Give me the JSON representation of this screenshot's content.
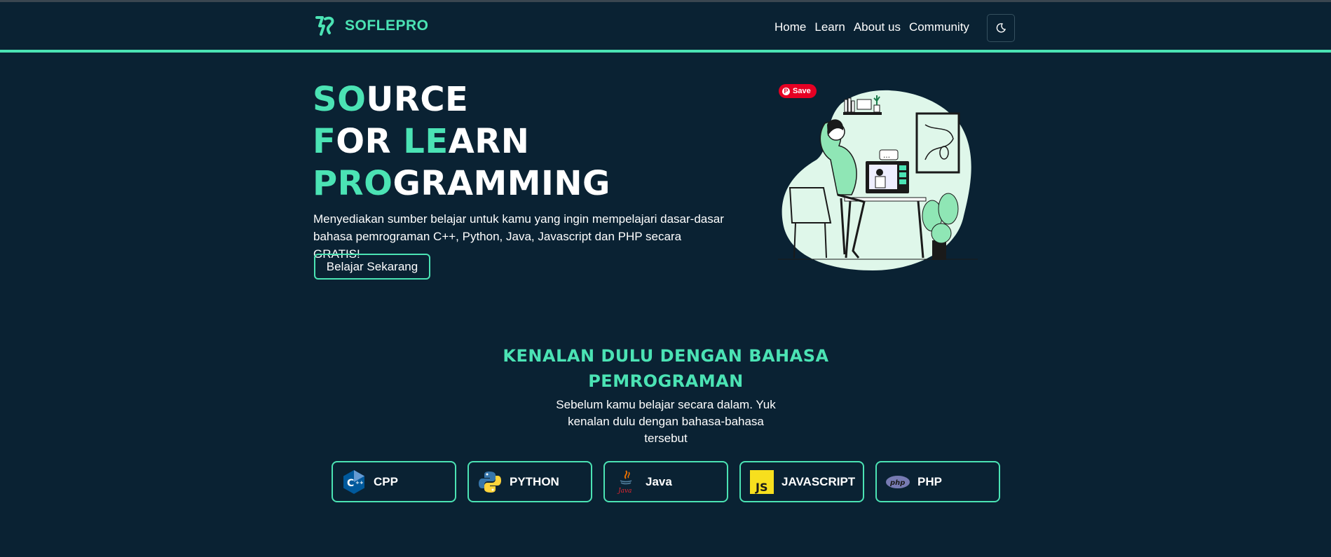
{
  "brand": {
    "name": "SOFLEPRO"
  },
  "nav": {
    "links": [
      "Home",
      "Learn",
      "About us",
      "Community"
    ],
    "theme_icon": "moon-icon"
  },
  "hero": {
    "title_lines": [
      {
        "accent": "SO",
        "rest": "URCE"
      },
      {
        "accent1": "F",
        "mid": "OR ",
        "accent2": "LE",
        "rest": "ARN"
      },
      {
        "accent": "PRO",
        "rest": "GRAMMING"
      }
    ],
    "description": "Menyediakan sumber belajar untuk kamu yang ingin mempelajari dasar-dasar bahasa pemrograman C++, Python, Java, Javascript dan PHP secara GRATIS!",
    "cta_label": "Belajar Sekarang",
    "pin_save_label": "Save"
  },
  "section": {
    "title": "KENALAN DULU DENGAN BAHASA PEMROGRAMAN",
    "description": "Sebelum kamu belajar secara dalam. Yuk kenalan dulu dengan bahasa-bahasa tersebut"
  },
  "languages": [
    {
      "label": "CPP",
      "icon": "cpp-icon"
    },
    {
      "label": "PYTHON",
      "icon": "python-icon"
    },
    {
      "label": "Java",
      "icon": "java-icon"
    },
    {
      "label": "JAVASCRIPT",
      "icon": "javascript-icon"
    },
    {
      "label": "PHP",
      "icon": "php-icon"
    }
  ],
  "colors": {
    "background": "#0a2233",
    "accent": "#4be3b4",
    "pinterest": "#e60023"
  }
}
